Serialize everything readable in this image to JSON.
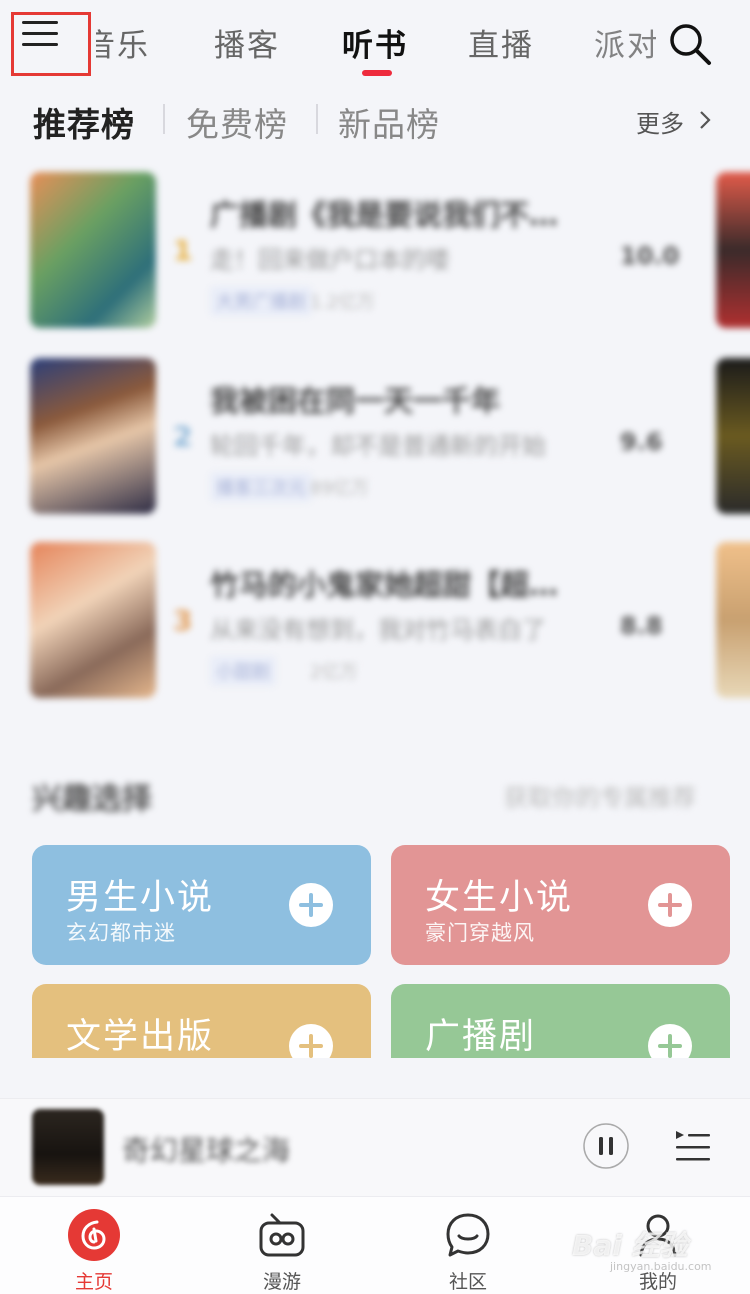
{
  "top_tabs": [
    {
      "label": "音乐"
    },
    {
      "label": "播客"
    },
    {
      "label": "听书"
    },
    {
      "label": "直播"
    },
    {
      "label": "派对"
    }
  ],
  "rank_tabs": [
    {
      "label": "推荐榜"
    },
    {
      "label": "免费榜"
    },
    {
      "label": "新品榜"
    }
  ],
  "more_label": "更多",
  "list_items": [
    {
      "rank": "1",
      "title": "广播剧《我是要说我们不…",
      "subtitle": "走！回来做户口本的喽",
      "tag": "大男广播剧",
      "count": "1.2亿万",
      "score": "10.0"
    },
    {
      "rank": "2",
      "title": "我被困在同一天一千年",
      "subtitle": "轮回千年，却不是普通新的开始",
      "tag": "播客三次元",
      "count": "89亿万",
      "score": "9.6"
    },
    {
      "rank": "3",
      "title": "竹马的小鬼家她超甜【超…",
      "subtitle": "从来没有想到，我对竹马表白了",
      "tag": "小甜剧",
      "count": "2亿万",
      "score": "8.8"
    }
  ],
  "interest": {
    "title": "兴趣选择",
    "hint": "获取你的专属推荐",
    "cards": [
      {
        "title": "男生小说",
        "subtitle": "玄幻都市迷",
        "color": "#8ebfe0"
      },
      {
        "title": "女生小说",
        "subtitle": "豪门穿越风",
        "color": "#e29595"
      },
      {
        "title": "文学出版",
        "subtitle": "",
        "color": "#e4c07e"
      },
      {
        "title": "广播剧",
        "subtitle": "",
        "color": "#96c896"
      }
    ]
  },
  "player": {
    "title": "奇幻星球之海"
  },
  "bottom_nav": [
    {
      "label": "主页",
      "icon": "netease-logo-icon"
    },
    {
      "label": "漫游",
      "icon": "radio-icon"
    },
    {
      "label": "社区",
      "icon": "chat-bubble-icon"
    },
    {
      "label": "我的",
      "icon": "user-icon"
    }
  ],
  "watermark": {
    "text": "Bai 经验",
    "sub": "jingyan.baidu.com"
  },
  "colors": {
    "accent": "#e53935",
    "underline": "#ee2b3d"
  }
}
